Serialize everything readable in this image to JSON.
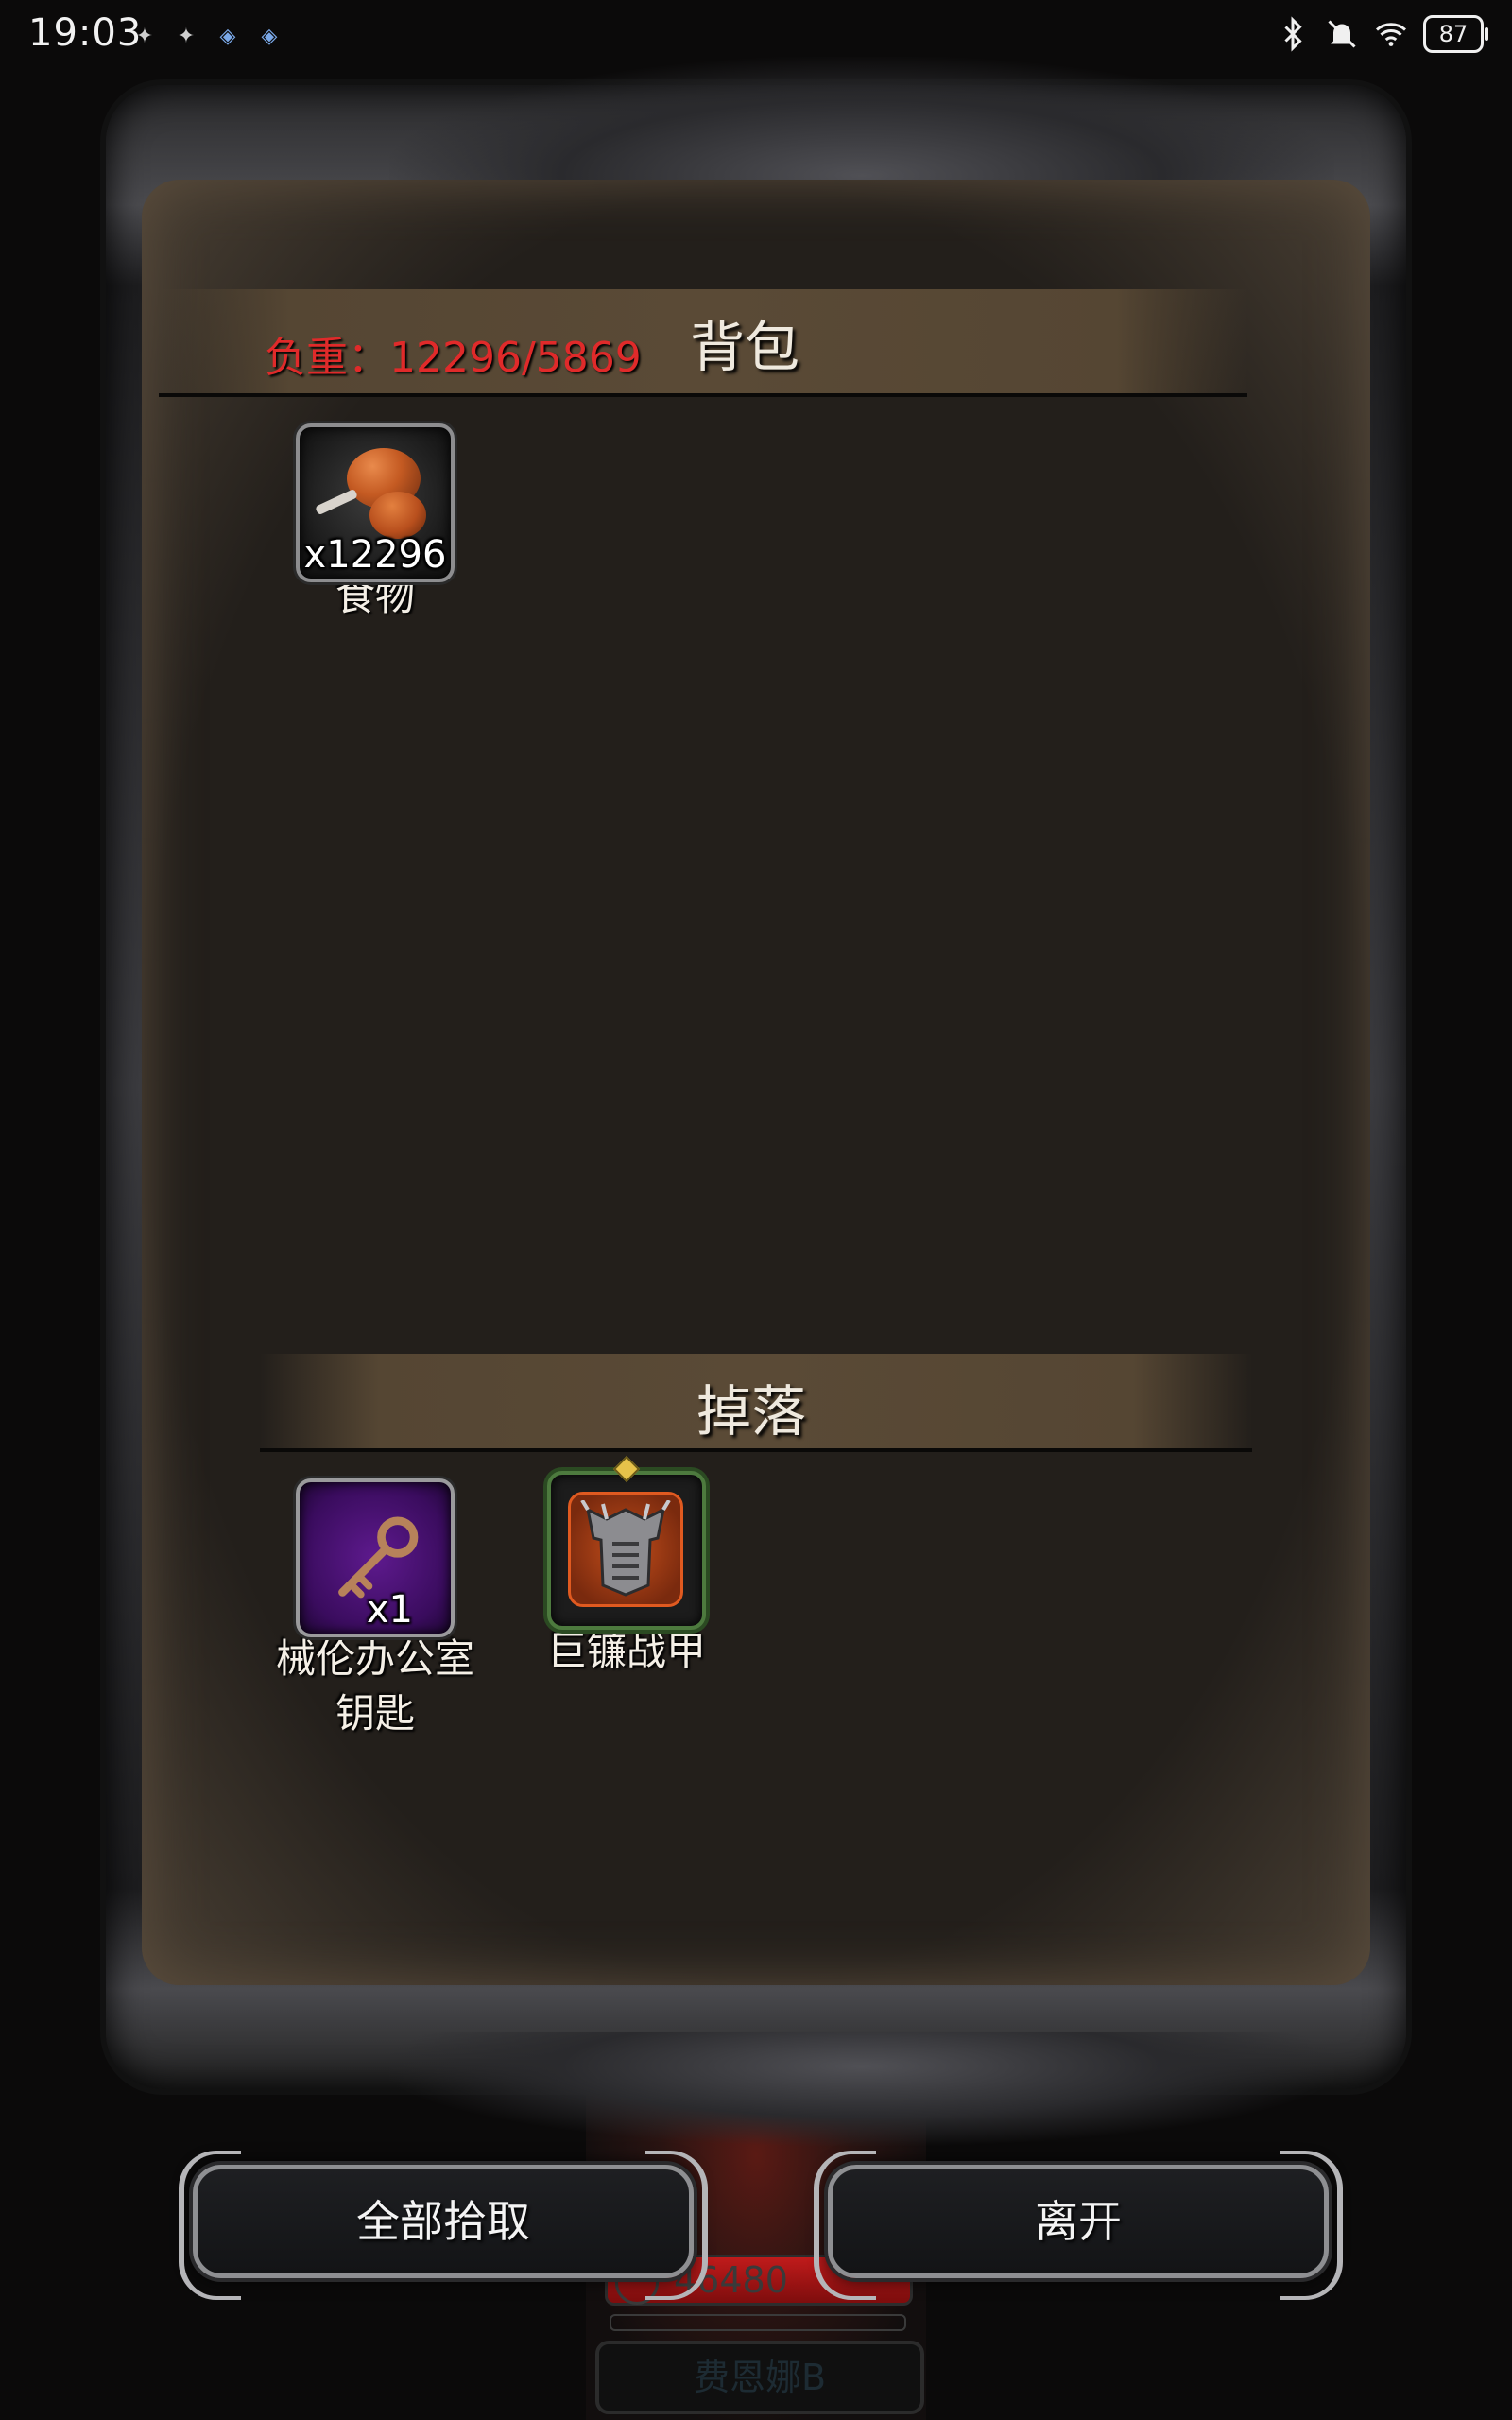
{
  "status_bar": {
    "time": "19:03",
    "battery": "87",
    "notification_icons": [
      "game-notification-icon",
      "game-notification-icon",
      "app-notification-icon",
      "app-notification-icon"
    ],
    "status_icons": [
      "bluetooth-icon",
      "mute-icon",
      "wifi-icon"
    ]
  },
  "bag": {
    "title": "背包",
    "weight_label": "负重：12296/5869",
    "items": [
      {
        "name": "食物",
        "count": "x12296",
        "icon": "roast-meat-icon"
      }
    ]
  },
  "drops": {
    "title": "掉落",
    "items": [
      {
        "name": "械伦办公室\n钥匙",
        "count": "x1",
        "icon": "key-icon",
        "rarity_color": "#5e1a8e"
      },
      {
        "name": "巨镰战甲",
        "count": "",
        "icon": "armor-icon",
        "rarity_color": "#4d7a3e"
      }
    ]
  },
  "buttons": {
    "pickup_all": "全部拾取",
    "leave": "离开"
  },
  "background": {
    "hp_value": "46480",
    "character_name": "费恩娜B"
  },
  "colors": {
    "weight_text": "#e02a2a",
    "panel_bg": "#231f1b",
    "header_band": "#5a4a36"
  }
}
